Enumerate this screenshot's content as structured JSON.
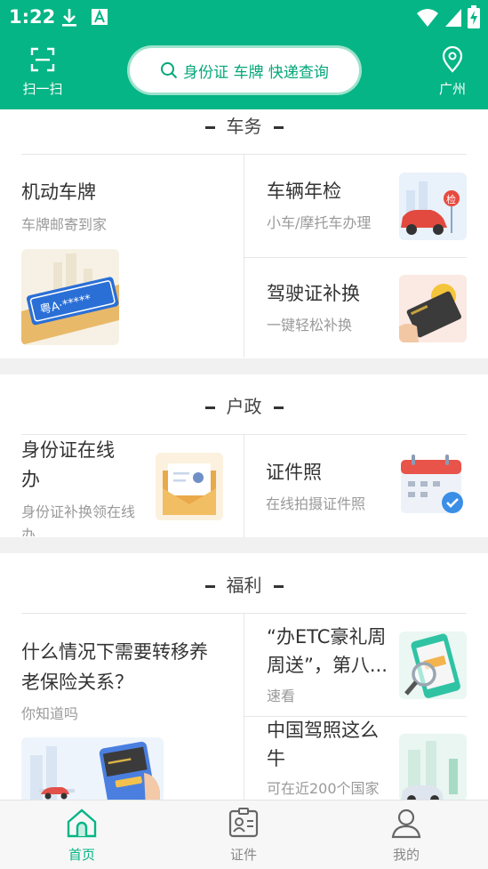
{
  "status_bar": {
    "time": "1:22"
  },
  "header": {
    "scan_label": "扫一扫",
    "search_placeholder": "身份证 车牌 快递查询",
    "city": "广州"
  },
  "sections": {
    "car": {
      "title": "车务",
      "plate": {
        "title": "机动车牌",
        "subtitle": "车牌邮寄到家",
        "plate_text": "粤A·*****"
      },
      "inspection": {
        "title": "车辆年检",
        "subtitle": "小车/摩托车办理",
        "badge": "检"
      },
      "license": {
        "title": "驾驶证补换",
        "subtitle": "一键轻松补换"
      }
    },
    "household": {
      "title": "户政",
      "idcard": {
        "title_line1": "身份证在线",
        "title_line2": "办",
        "subtitle_line1": "身份证补换领在线",
        "subtitle_line2": "办"
      },
      "photo": {
        "title": "证件照",
        "subtitle": "在线拍摄证件照"
      }
    },
    "welfare": {
      "title": "福利",
      "pension": {
        "title_line1": "什么情况下需要转移养",
        "title_line2": "老保险关系？",
        "subtitle": "你知道吗"
      },
      "etc": {
        "title_line1": "“办ETC豪礼周",
        "title_line2": "周送”，第八...",
        "subtitle": "速看"
      },
      "driving": {
        "title_line1": "中国驾照这么",
        "title_line2": "牛",
        "subtitle": "可在近200个国家"
      }
    }
  },
  "nav": {
    "home": "首页",
    "cert": "证件",
    "mine": "我的"
  },
  "colors": {
    "brand": "#05b585",
    "brand_light": "#9fe2cd",
    "divider": "#f1f1f1"
  }
}
